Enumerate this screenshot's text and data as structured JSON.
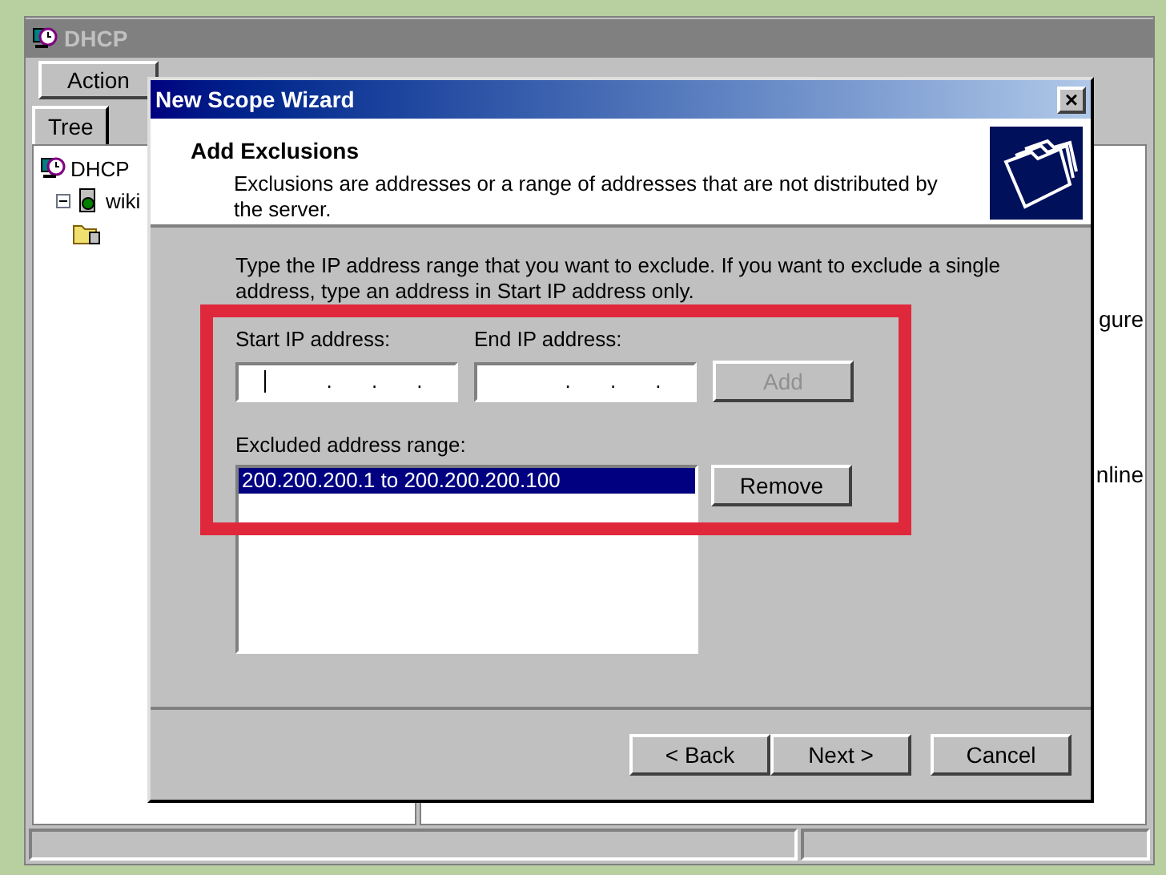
{
  "window": {
    "title": "DHCP",
    "menu": [
      "Action"
    ],
    "tabs": [
      {
        "label": "Tree",
        "selected": true
      }
    ],
    "tree": [
      {
        "label": "DHCP",
        "kind": "dhcp",
        "children": [
          {
            "label": "wiki",
            "kind": "server",
            "expanded": true,
            "children": [
              {
                "kind": "folder"
              }
            ]
          }
        ]
      }
    ],
    "right_pane_texts": [
      "gure",
      "nline"
    ]
  },
  "dialog": {
    "title": "New Scope Wizard",
    "close": "×",
    "heading": "Add Exclusions",
    "subheading": "Exclusions are addresses or a range of addresses that are not distributed by the server.",
    "instructions": "Type the IP address range that you want to exclude. If you want to exclude a single address, type an address in Start IP address only.",
    "fields": [
      {
        "label": "Start IP address:",
        "dots": [
          ".",
          ".",
          "."
        ],
        "focused": true
      },
      {
        "label": "End IP address:",
        "dots": [
          ".",
          ".",
          "."
        ],
        "focused": false
      }
    ],
    "add_button": {
      "label": "Add",
      "disabled": true
    },
    "list_label": "Excluded address range:",
    "ranges": [
      {
        "text": "200.200.200.1 to 200.200.200.100",
        "selected": true
      }
    ],
    "remove_button": {
      "label": "Remove",
      "disabled": false
    },
    "buttons": [
      "< Back",
      "Next >",
      "Cancel"
    ],
    "highlight": true
  }
}
